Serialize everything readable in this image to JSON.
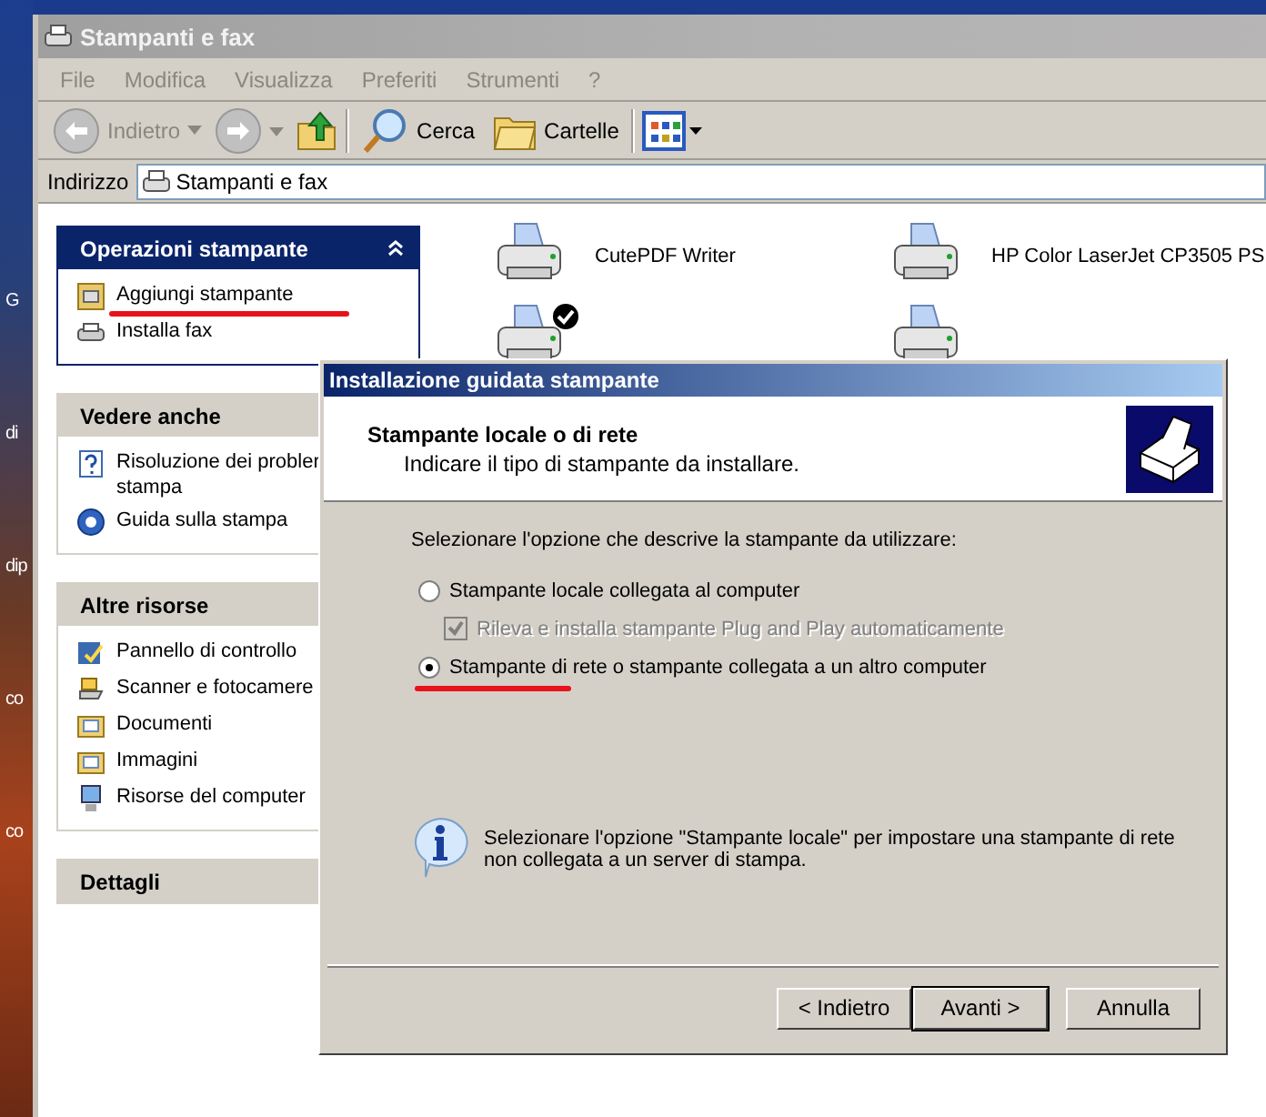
{
  "desktop_labels": [
    "G",
    "di",
    "dip",
    "co",
    "co"
  ],
  "window": {
    "title": "Stampanti e fax"
  },
  "menu": [
    "File",
    "Modifica",
    "Visualizza",
    "Preferiti",
    "Strumenti",
    "?"
  ],
  "toolbar": {
    "back": "Indietro",
    "search": "Cerca",
    "folders": "Cartelle"
  },
  "address": {
    "label": "Indirizzo",
    "value": "Stampanti e fax"
  },
  "task_panes": [
    {
      "title": "Operazioni stampante",
      "kind": "special",
      "items": [
        {
          "label": "Aggiungi stampante",
          "underlined": true
        },
        {
          "label": "Installa fax",
          "underlined": false
        }
      ]
    },
    {
      "title": "Vedere anche",
      "kind": "normal",
      "items": [
        {
          "label": "Risoluzione dei probler stampa",
          "underlined": false
        },
        {
          "label": "Guida sulla stampa",
          "underlined": false
        }
      ]
    },
    {
      "title": "Altre risorse",
      "kind": "normal",
      "items": [
        {
          "label": "Pannello di controllo",
          "underlined": false
        },
        {
          "label": "Scanner e fotocamere",
          "underlined": false
        },
        {
          "label": "Documenti",
          "underlined": false
        },
        {
          "label": "Immagini",
          "underlined": false
        },
        {
          "label": "Risorse del computer",
          "underlined": false
        }
      ]
    },
    {
      "title": "Dettagli",
      "kind": "normal"
    }
  ],
  "printers": [
    {
      "name": "CutePDF Writer",
      "default": false
    },
    {
      "name": "HP Color LaserJet CP3505 PS",
      "default": false
    },
    {
      "default": true
    },
    {
      "default": false
    }
  ],
  "dialog": {
    "title": "Installazione guidata stampante",
    "heading": "Stampante locale o di rete",
    "subheading": "Indicare il tipo di stampante da installare.",
    "prompt": "Selezionare l'opzione che descrive la stampante da utilizzare:",
    "options": [
      {
        "kind": "radio",
        "label": "Stampante locale collegata al computer",
        "selected": false,
        "underlined": false
      },
      {
        "kind": "checkbox",
        "label": "Rileva e installa stampante Plug and Play automaticamente",
        "checked": true,
        "disabled": true
      },
      {
        "kind": "radio",
        "label": "Stampante di rete o stampante collegata a un altro computer",
        "selected": true,
        "underlined": true
      }
    ],
    "info": "Selezionare l'opzione \"Stampante locale\" per impostare una stampante di rete non collegata a un server di stampa.",
    "buttons": [
      {
        "label": "< Indietro",
        "default": false
      },
      {
        "label": "Avanti >",
        "default": true
      },
      {
        "label": "Annulla",
        "default": false
      }
    ]
  }
}
